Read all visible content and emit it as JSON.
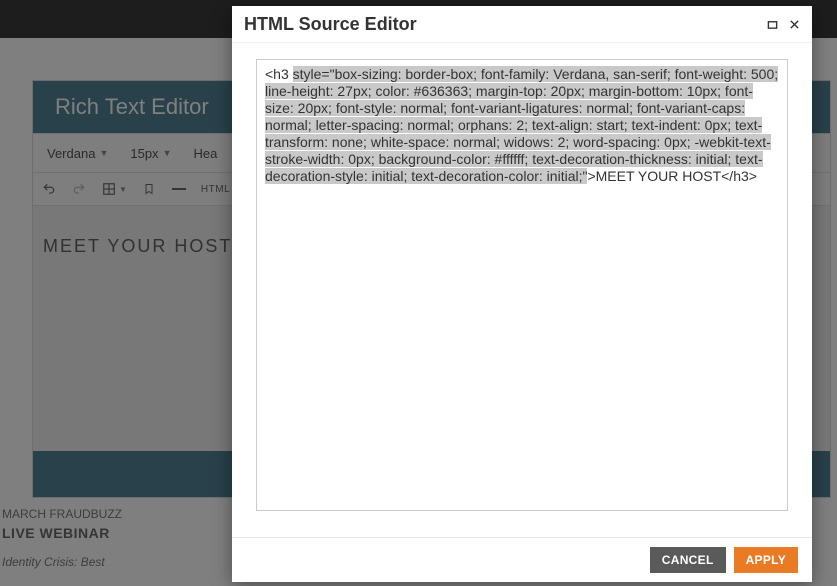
{
  "editor": {
    "title": "Rich Text Editor",
    "font_dropdown": "Verdana",
    "size_dropdown": "15px",
    "style_dropdown": "Hea",
    "content_text": "MEET YOUR HOST",
    "html_label": "HTML"
  },
  "background": {
    "line1": "MARCH FRAUDBUZZ",
    "line2": "LIVE WEBINAR",
    "line3": "Identity Crisis: Best"
  },
  "modal": {
    "title": "HTML Source Editor",
    "source_prefix": "<h3 ",
    "source_highlighted": "style=\"box-sizing: border-box; font-family: Verdana, san-serif; font-weight: 500; line-height: 27px; color: #636363; margin-top: 20px; margin-bottom: 10px; font-size: 20px; font-style: normal; font-variant-ligatures: normal; font-variant-caps: normal; letter-spacing: normal; orphans: 2; text-align: start; text-indent: 0px; text-transform: none; white-space: normal; widows: 2; word-spacing: 0px; -webkit-text-stroke-width: 0px; background-color: #ffffff; text-decoration-thickness: initial; text-decoration-style: initial; text-decoration-color: initial;\"",
    "source_suffix": ">MEET YOUR HOST</h3>",
    "buttons": {
      "cancel": "CANCEL",
      "apply": "APPLY"
    }
  }
}
